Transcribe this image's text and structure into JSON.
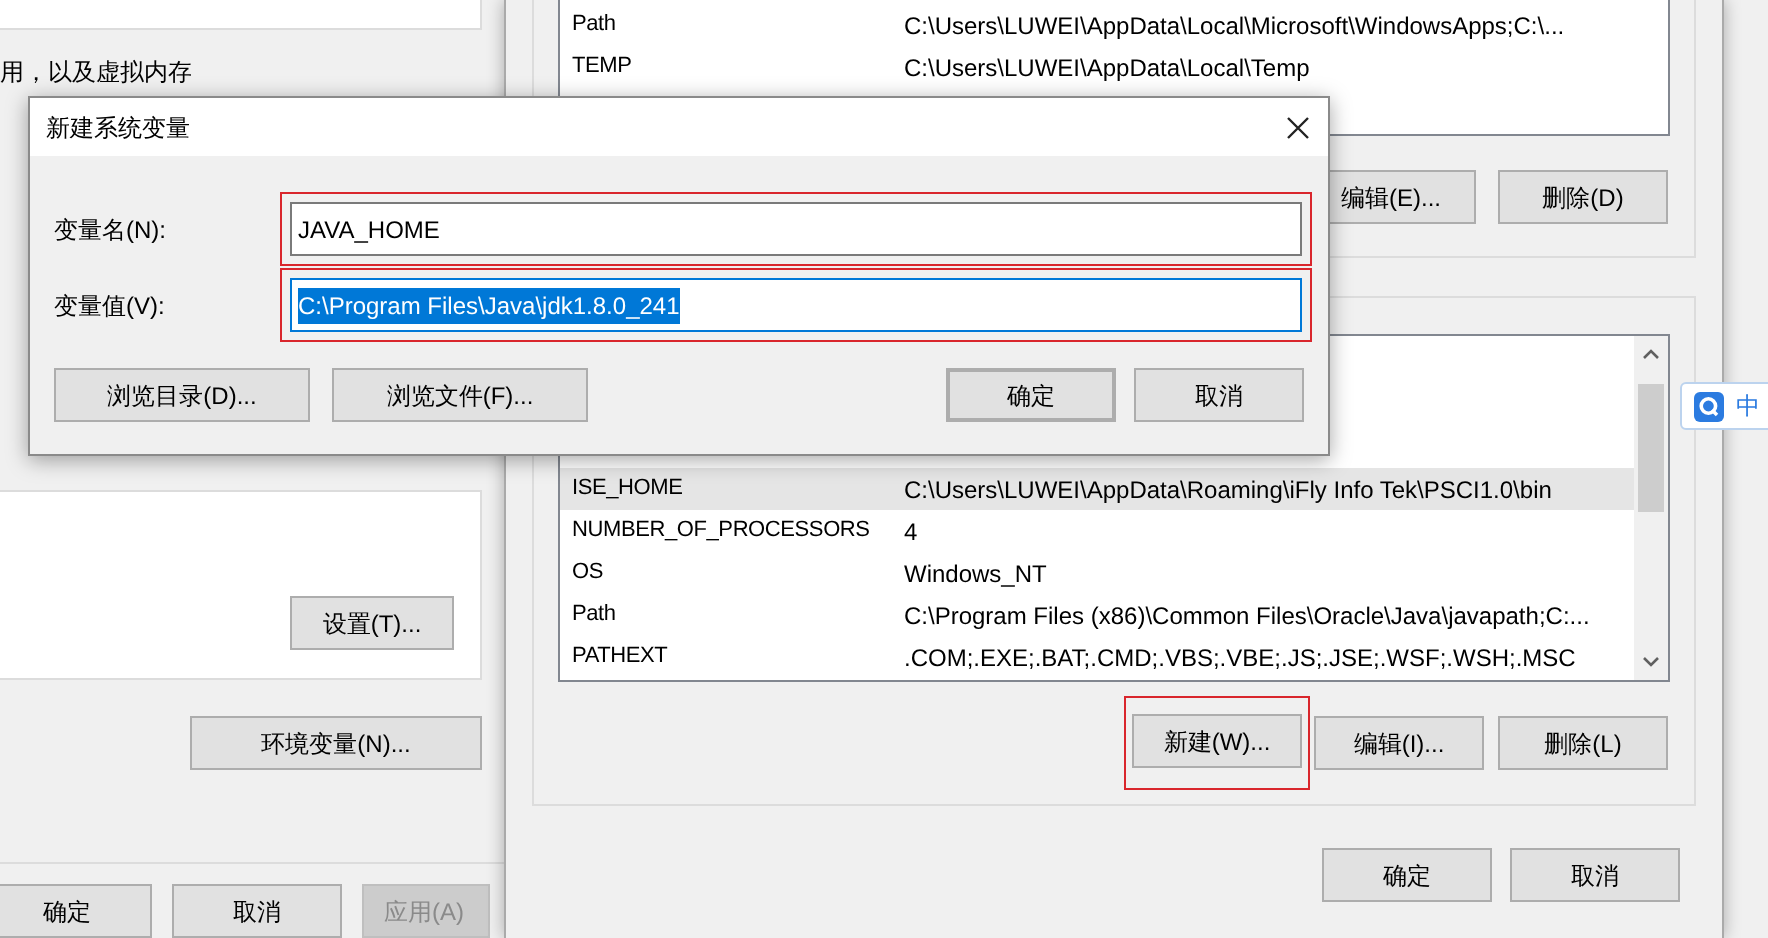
{
  "system_properties": {
    "note": "用，以及虚拟内存",
    "settings_button": "设置(T)...",
    "env_button": "环境变量(N)...",
    "buttons": [
      {
        "label": "确定",
        "disabled": false
      },
      {
        "label": "取消",
        "disabled": false
      },
      {
        "label": "应用(A)",
        "disabled": true
      }
    ]
  },
  "env_window": {
    "user_vars": {
      "rows": [
        {
          "name": "Path",
          "value": "C:\\Users\\LUWEI\\AppData\\Local\\Microsoft\\WindowsApps;C:\\...",
          "selected": false
        },
        {
          "name": "TEMP",
          "value": "C:\\Users\\LUWEI\\AppData\\Local\\Temp",
          "selected": false
        }
      ],
      "buttons": [
        {
          "label": "编辑(E)...",
          "highlighted": false
        },
        {
          "label": "删除(D)",
          "highlighted": false
        }
      ]
    },
    "system_vars": {
      "rows": [
        {
          "name": "ISE_HOME",
          "value": "C:\\Users\\LUWEI\\AppData\\Roaming\\iFly Info Tek\\PSCI1.0\\bin",
          "selected": true
        },
        {
          "name": "NUMBER_OF_PROCESSORS",
          "value": "4",
          "selected": false
        },
        {
          "name": "OS",
          "value": "Windows_NT",
          "selected": false
        },
        {
          "name": "Path",
          "value": "C:\\Program Files (x86)\\Common Files\\Oracle\\Java\\javapath;C:...",
          "selected": false
        },
        {
          "name": "PATHEXT",
          "value": ".COM;.EXE;.BAT;.CMD;.VBS;.VBE;.JS;.JSE;.WSF;.WSH;.MSC",
          "selected": false
        }
      ],
      "buttons": [
        {
          "label": "新建(W)...",
          "highlighted": true
        },
        {
          "label": "编辑(I)...",
          "highlighted": false
        },
        {
          "label": "删除(L)",
          "highlighted": false
        }
      ]
    },
    "buttons": [
      "确定",
      "取消"
    ]
  },
  "dialog": {
    "title": "新建系统变量",
    "fields": [
      {
        "label": "变量名(N):",
        "value": "JAVA_HOME",
        "highlighted": true,
        "selected": false
      },
      {
        "label": "变量值(V):",
        "value": "C:\\Program Files\\Java\\jdk1.8.0_241",
        "highlighted": true,
        "selected": true
      }
    ],
    "browse_buttons": [
      "浏览目录(D)...",
      "浏览文件(F)..."
    ],
    "buttons": [
      {
        "label": "确定",
        "default": true
      },
      {
        "label": "取消",
        "default": false
      }
    ]
  },
  "ime_toolbar": {
    "label": "中"
  }
}
